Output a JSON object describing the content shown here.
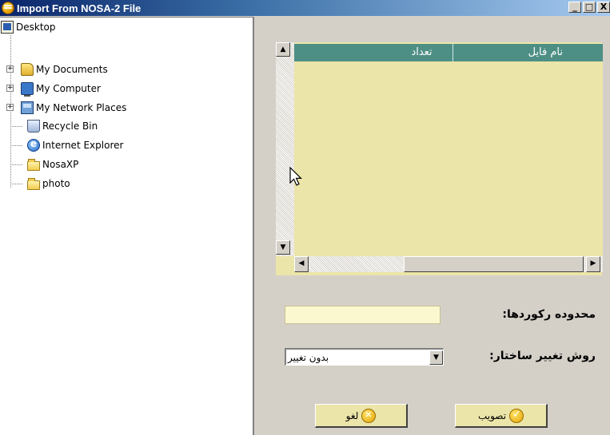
{
  "window": {
    "title": "Import From NOSA-2 File",
    "min_label": "_",
    "max_label": "□",
    "close_label": "X"
  },
  "tree": {
    "items": [
      {
        "label": "Desktop",
        "icon": "desktop-icon"
      },
      {
        "label": "My Documents",
        "icon": "my-documents-icon",
        "expandable": true
      },
      {
        "label": "My Computer",
        "icon": "my-computer-icon",
        "expandable": true
      },
      {
        "label": "My Network Places",
        "icon": "network-places-icon",
        "expandable": true
      },
      {
        "label": "Recycle Bin",
        "icon": "recycle-bin-icon"
      },
      {
        "label": "Internet Explorer",
        "icon": "internet-explorer-icon"
      },
      {
        "label": "NosaXP",
        "icon": "folder-icon"
      },
      {
        "label": "photo",
        "icon": "folder-icon"
      }
    ]
  },
  "grid": {
    "columns": {
      "file_name": "نام فايل",
      "count": "تعداد"
    },
    "rows": [],
    "background": "#ece5a9",
    "header_color": "#4e8f85"
  },
  "form": {
    "record_range_label": "محدوده رکوردها:",
    "record_range_value": "",
    "structure_change_label": "روش تغيير ساختار:",
    "structure_change_value": "بدون تغيير"
  },
  "buttons": {
    "approve_label": "تصويب",
    "cancel_label": "لغو"
  }
}
